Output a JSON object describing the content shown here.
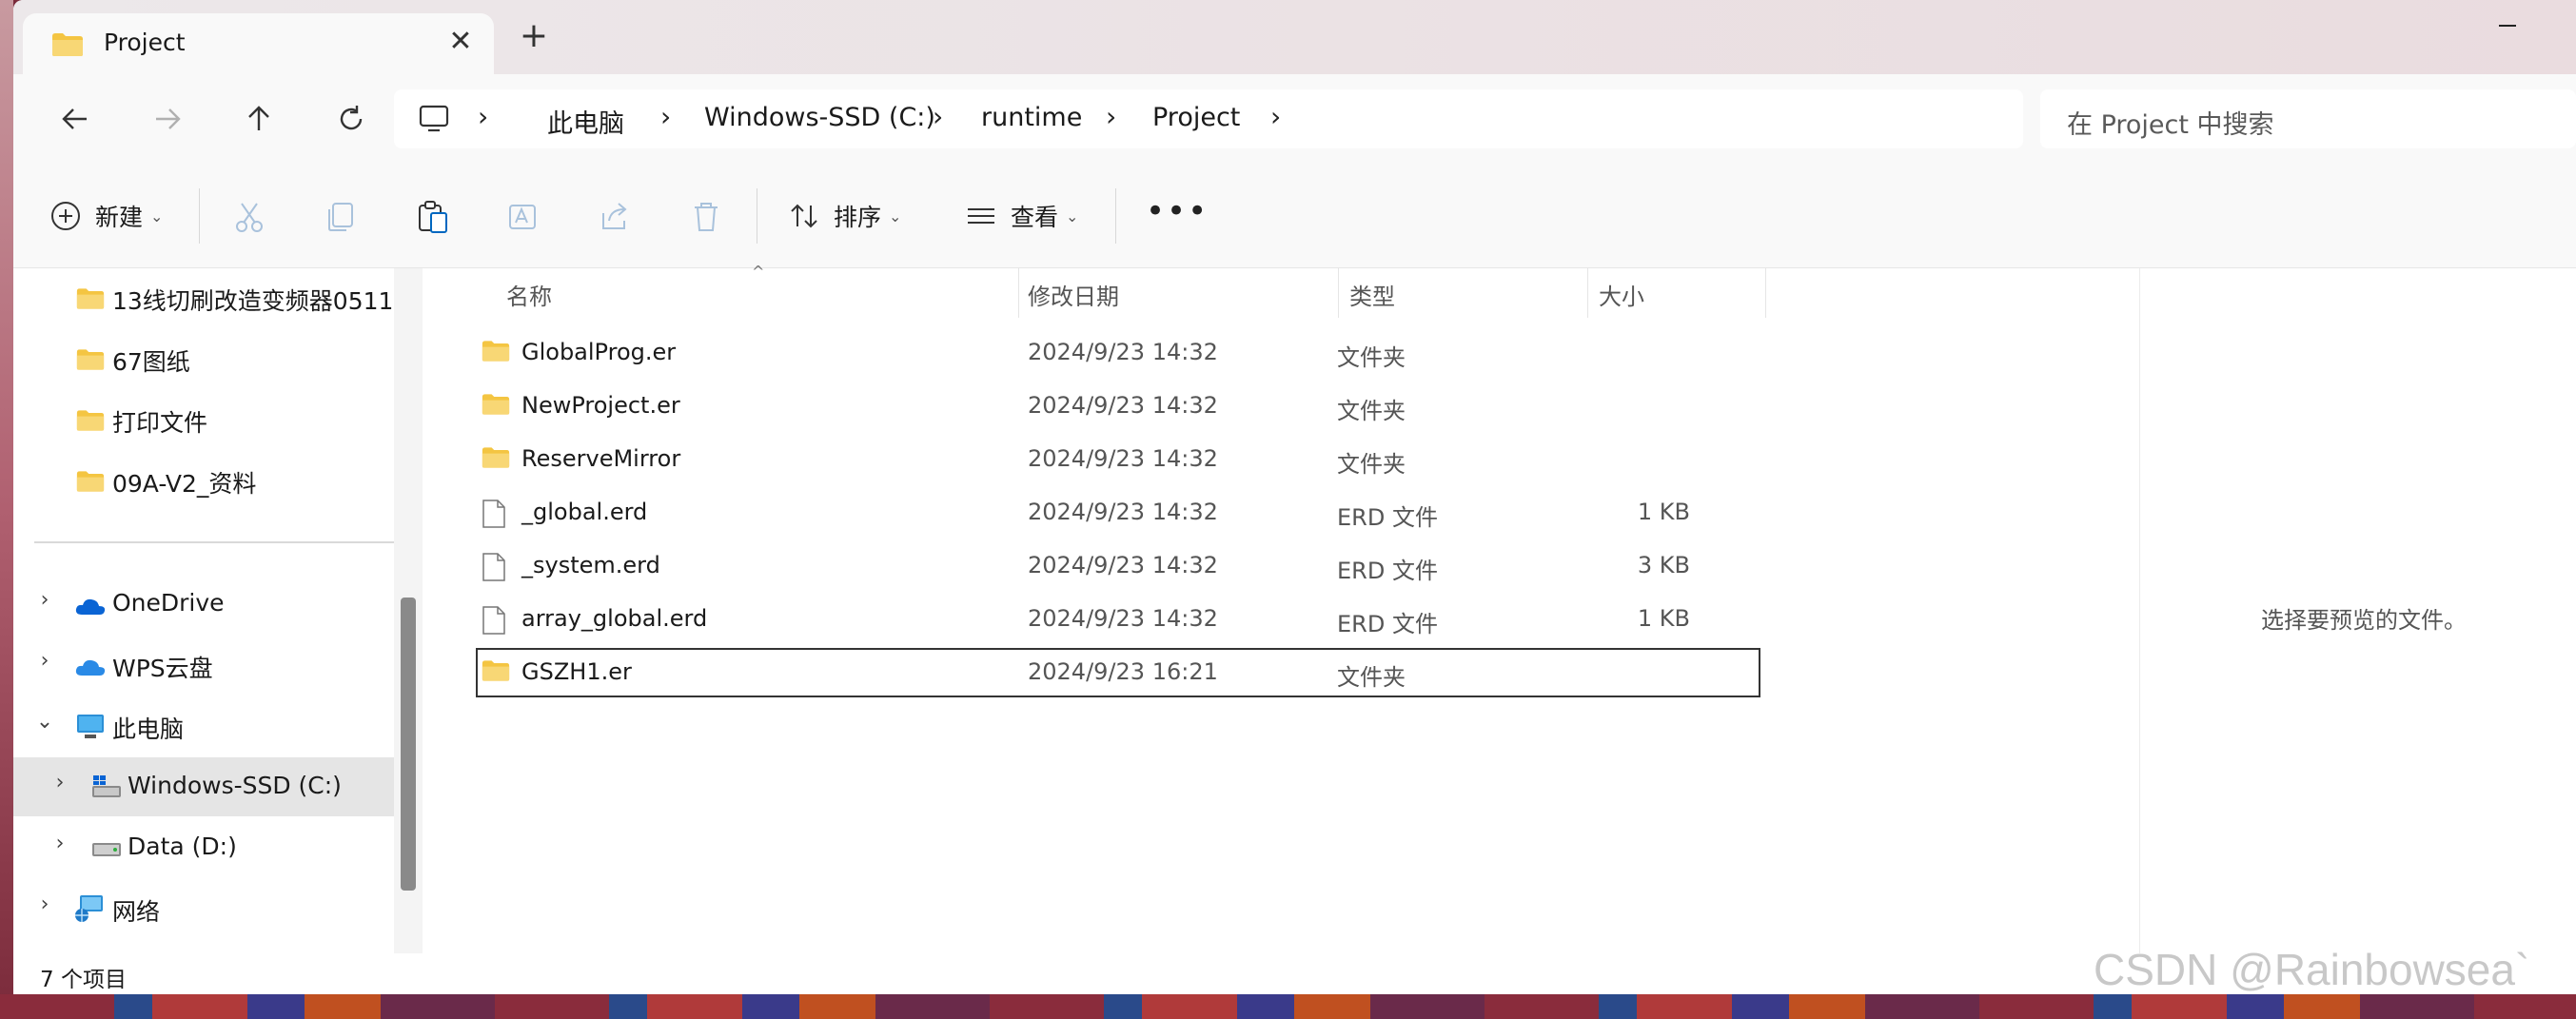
{
  "tab": {
    "title": "Project"
  },
  "navbar": {
    "breadcrumbs": [
      "此电脑",
      "Windows-SSD (C:)",
      "runtime",
      "Project"
    ],
    "search_placeholder": "在 Project 中搜索"
  },
  "toolbar": {
    "new_label": "新建",
    "sort_label": "排序",
    "view_label": "查看"
  },
  "sidebar": {
    "pinned": [
      {
        "label": "13线切刷改造变频器0511",
        "icon": "folder-icon"
      },
      {
        "label": "67图纸",
        "icon": "folder-icon"
      },
      {
        "label": "打印文件",
        "icon": "folder-icon"
      },
      {
        "label": "09A-V2_资料",
        "icon": "folder-icon"
      }
    ],
    "tree": [
      {
        "label": "OneDrive",
        "icon": "cloud-icon"
      },
      {
        "label": "WPS云盘",
        "icon": "cloud-icon"
      },
      {
        "label": "此电脑",
        "icon": "pc-icon"
      },
      {
        "label": "Windows-SSD (C:)",
        "icon": "system-drive-icon"
      },
      {
        "label": "Data (D:)",
        "icon": "drive-icon"
      },
      {
        "label": "网络",
        "icon": "network-icon"
      }
    ]
  },
  "columns": {
    "name": "名称",
    "date": "修改日期",
    "type": "类型",
    "size": "大小"
  },
  "files": [
    {
      "name": "GlobalProg.er",
      "date": "2024/9/23 14:32",
      "type": "文件夹",
      "size": "",
      "icon": "folder-icon"
    },
    {
      "name": "NewProject.er",
      "date": "2024/9/23 14:32",
      "type": "文件夹",
      "size": "",
      "icon": "folder-icon"
    },
    {
      "name": "ReserveMirror",
      "date": "2024/9/23 14:32",
      "type": "文件夹",
      "size": "",
      "icon": "folder-icon"
    },
    {
      "name": "_global.erd",
      "date": "2024/9/23 14:32",
      "type": "ERD 文件",
      "size": "1 KB",
      "icon": "file-icon"
    },
    {
      "name": "_system.erd",
      "date": "2024/9/23 14:32",
      "type": "ERD 文件",
      "size": "3 KB",
      "icon": "file-icon"
    },
    {
      "name": "array_global.erd",
      "date": "2024/9/23 14:32",
      "type": "ERD 文件",
      "size": "1 KB",
      "icon": "file-icon"
    },
    {
      "name": "GSZH1.er",
      "date": "2024/9/23 16:21",
      "type": "文件夹",
      "size": "",
      "icon": "folder-icon"
    }
  ],
  "preview": {
    "message": "选择要预览的文件。"
  },
  "status": {
    "item_count": "7 个项目"
  },
  "watermark": "CSDN @Rainbowsea`",
  "colors": {
    "folder": "#f4c542",
    "accent": "#0067c0",
    "selected_bg": "#e5e5e5"
  }
}
